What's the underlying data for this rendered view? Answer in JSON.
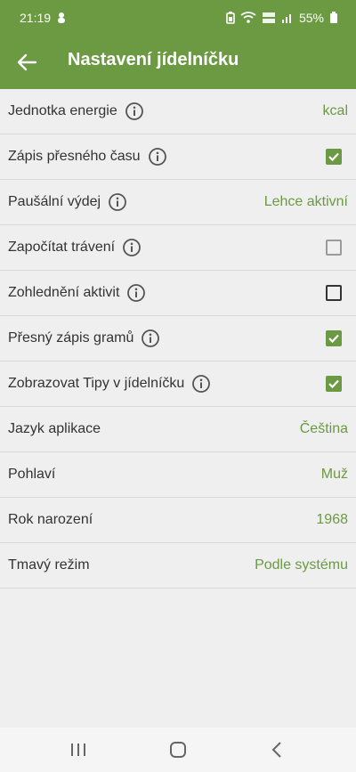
{
  "status_bar": {
    "time": "21:19",
    "battery_percent": "55%"
  },
  "toolbar": {
    "title": "Nastavení jídelníčku"
  },
  "settings": [
    {
      "label": "Jednotka energie",
      "info": true,
      "type": "value",
      "value": "kcal"
    },
    {
      "label": "Zápis přesného času",
      "info": true,
      "type": "checkbox",
      "checked": true
    },
    {
      "label": "Paušální výdej",
      "info": true,
      "type": "value",
      "value": "Lehce aktivní"
    },
    {
      "label": "Započítat trávení",
      "info": true,
      "type": "checkbox",
      "checked": false,
      "disabled": true
    },
    {
      "label": "Zohlednění aktivit",
      "info": true,
      "type": "checkbox",
      "checked": false
    },
    {
      "label": "Přesný zápis gramů",
      "info": true,
      "type": "checkbox",
      "checked": true
    },
    {
      "label": "Zobrazovat Tipy v jídelníčku",
      "info": true,
      "type": "checkbox",
      "checked": true
    },
    {
      "label": "Jazyk aplikace",
      "info": false,
      "type": "value",
      "value": "Čeština"
    },
    {
      "label": "Pohlaví",
      "info": false,
      "type": "value",
      "value": "Muž"
    },
    {
      "label": "Rok narození",
      "info": false,
      "type": "value",
      "value": "1968"
    },
    {
      "label": "Tmavý režim",
      "info": false,
      "type": "value",
      "value": "Podle systému"
    }
  ],
  "colors": {
    "accent": "#6b9a43",
    "background": "#efefef"
  }
}
